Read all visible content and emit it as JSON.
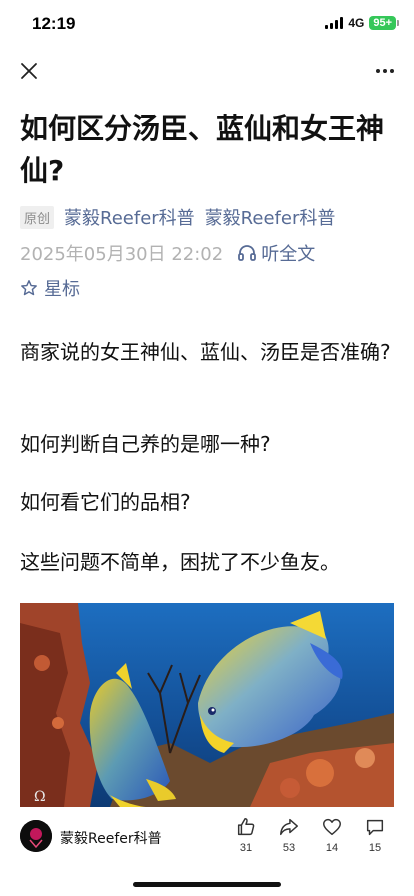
{
  "status_bar": {
    "time": "12:19",
    "network": "4G",
    "battery": "95+"
  },
  "nav": {
    "close_icon": "close-icon",
    "more_icon": "more-icon"
  },
  "article": {
    "title": "如何区分汤臣、蓝仙和女王神仙?",
    "original_tag": "原创",
    "author_link": "蒙毅Reefer科普",
    "account_link": "蒙毅Reefer科普",
    "date": "2025年05月30日 22:02",
    "listen_label": "听全文",
    "star_label": "星标",
    "paragraphs": [
      "商家说的女王神仙、蓝仙、汤臣是否准确?",
      "如何判断自己养的是哪一种?",
      "如何看它们的品相?",
      "这些问题不简单，困扰了不少鱼友。"
    ],
    "image_watermark": "Ω"
  },
  "bottom_bar": {
    "author_name": "蒙毅Reefer科普",
    "actions": [
      {
        "icon": "thumbs-up-icon",
        "count": "31"
      },
      {
        "icon": "share-icon",
        "count": "53"
      },
      {
        "icon": "heart-icon",
        "count": "14"
      },
      {
        "icon": "comment-icon",
        "count": "15"
      }
    ]
  },
  "colors": {
    "link": "#576b95",
    "date": "#b2b2b2",
    "battery": "#35c759",
    "ocean": "#1a5fb0"
  }
}
